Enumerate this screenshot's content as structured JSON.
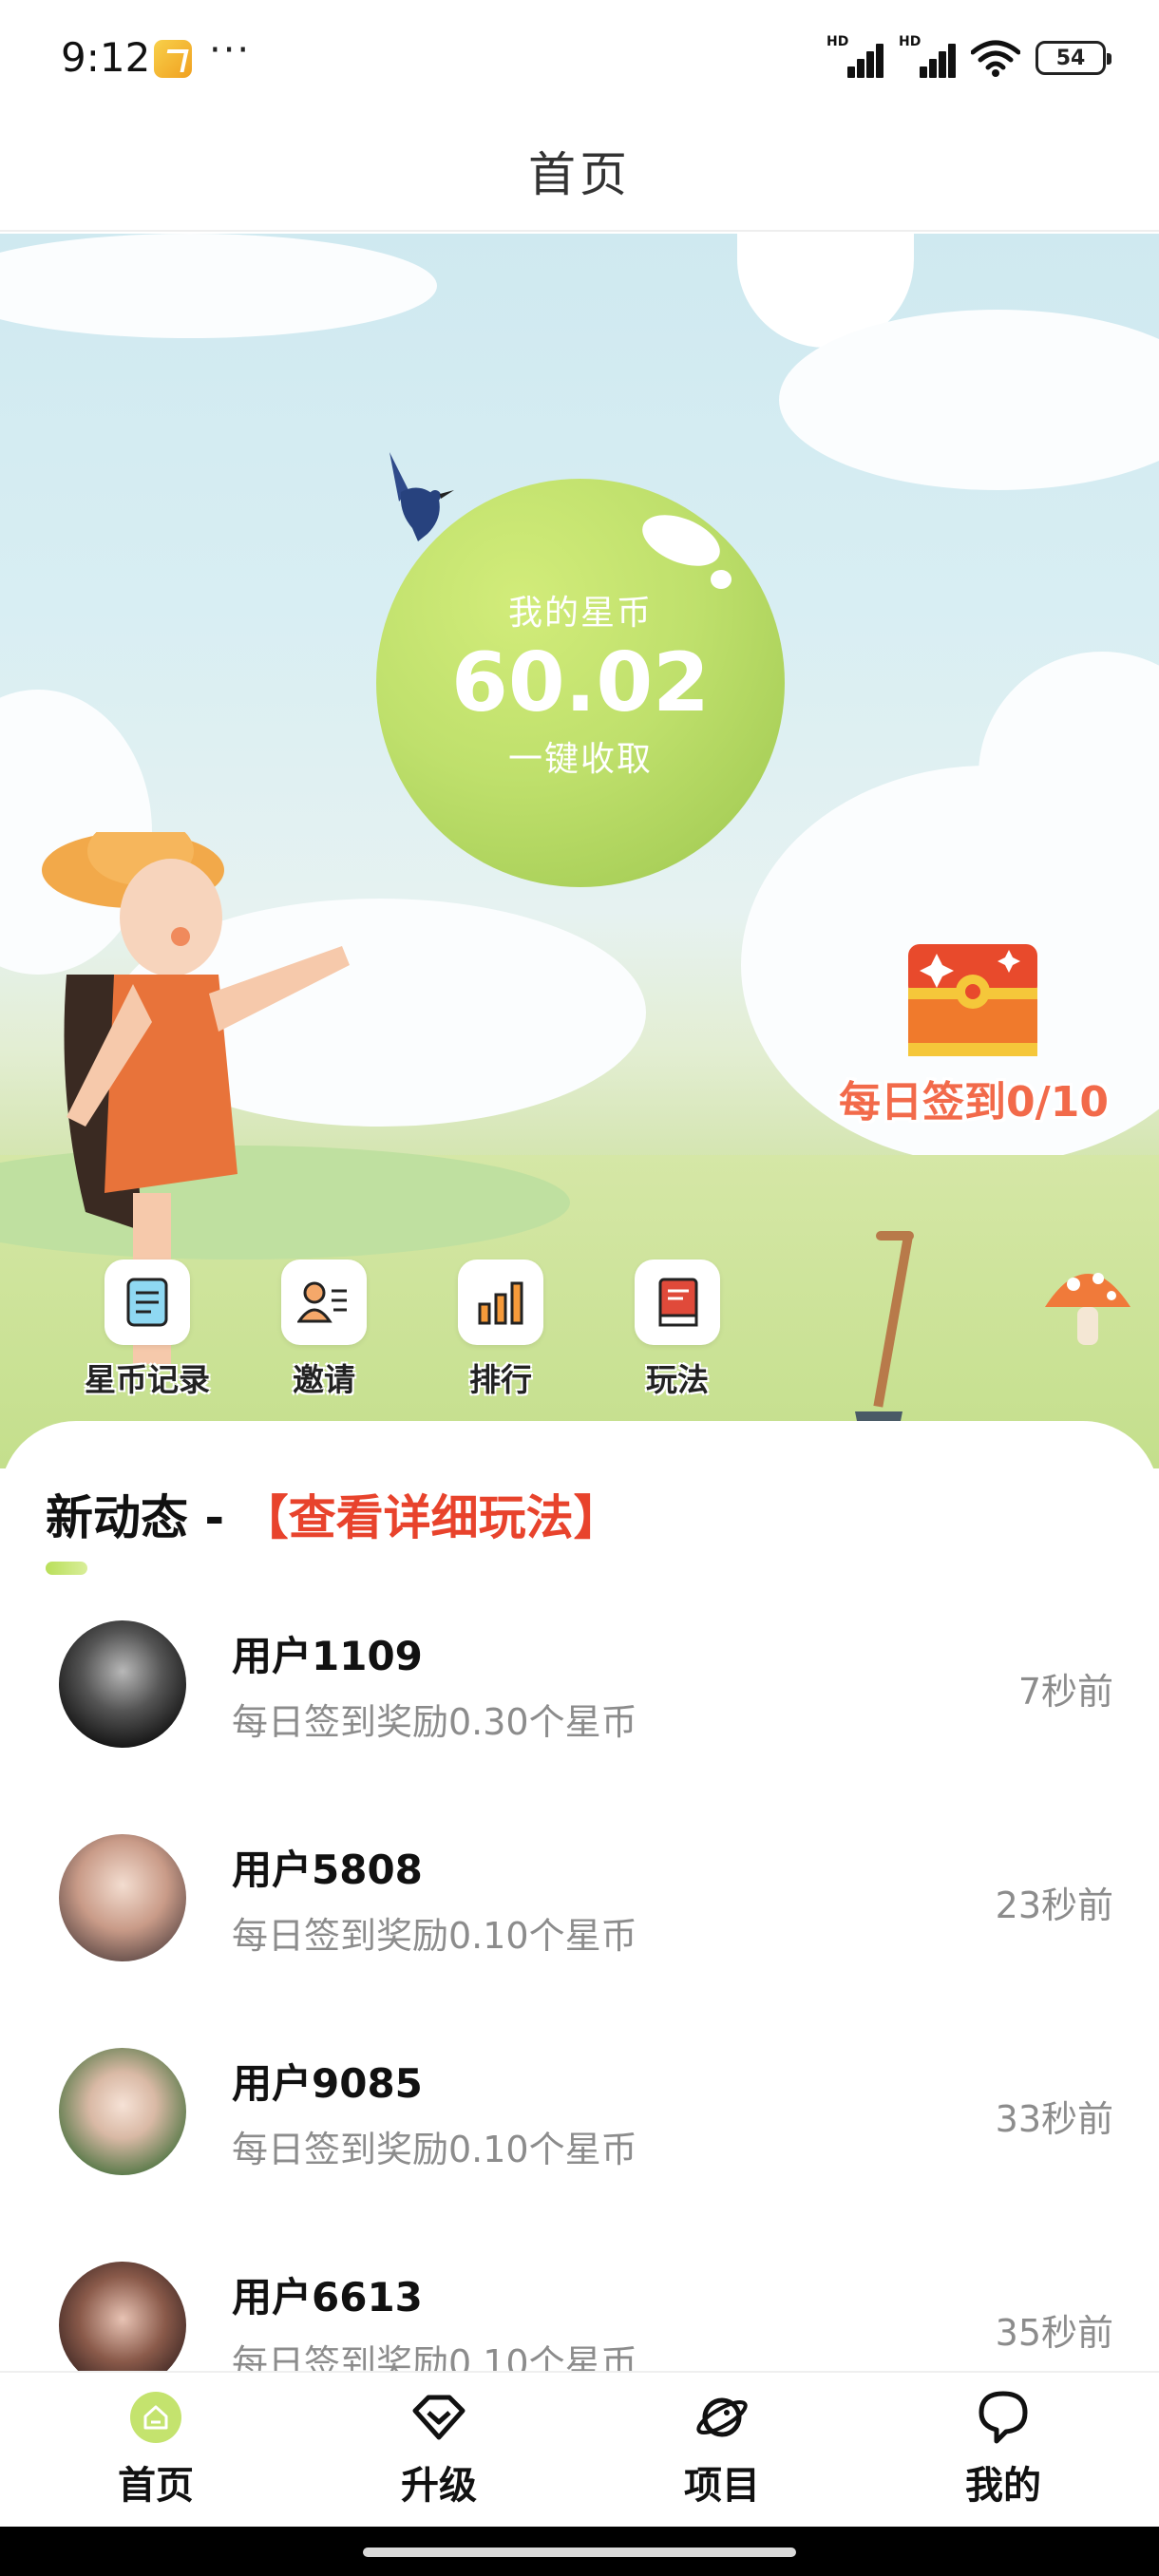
{
  "status_bar": {
    "time": "9:12",
    "dots": "···",
    "signal_label_1": "HD",
    "signal_label_2": "HD",
    "battery": "54"
  },
  "header": {
    "title": "首页"
  },
  "hero": {
    "coin_label": "我的星币",
    "coin_value": "60.02",
    "coin_action": "一键收取",
    "checkin_text": "每日签到0/10"
  },
  "quick_menu": [
    {
      "label": "星币记录",
      "icon": "document-list-icon"
    },
    {
      "label": "邀请",
      "icon": "user-card-icon"
    },
    {
      "label": "排行",
      "icon": "bar-chart-icon"
    },
    {
      "label": "玩法",
      "icon": "book-icon"
    }
  ],
  "feed": {
    "title": "新动态 - ",
    "link": "【查看详细玩法】",
    "items": [
      {
        "user": "用户1109",
        "desc": "每日签到奖励0.30个星币",
        "time": "7秒前"
      },
      {
        "user": "用户5808",
        "desc": "每日签到奖励0.10个星币",
        "time": "23秒前"
      },
      {
        "user": "用户9085",
        "desc": "每日签到奖励0.10个星币",
        "time": "33秒前"
      },
      {
        "user": "用户6613",
        "desc": "每日签到奖励0.10个星币",
        "time": "35秒前"
      }
    ]
  },
  "tabs": [
    {
      "label": "首页",
      "icon": "home-icon",
      "active": true
    },
    {
      "label": "升级",
      "icon": "diamond-icon",
      "active": false
    },
    {
      "label": "项目",
      "icon": "planet-icon",
      "active": false
    },
    {
      "label": "我的",
      "icon": "chat-bubble-icon",
      "active": false
    }
  ],
  "colors": {
    "accent_green": "#b9df5a",
    "link_red": "#e8432c",
    "checkin_orange": "#f26a4a"
  }
}
